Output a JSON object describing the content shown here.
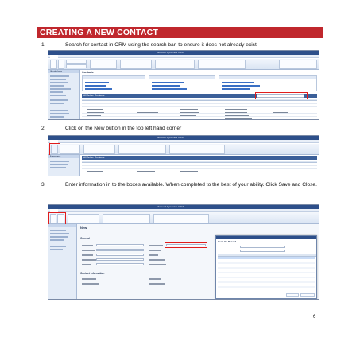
{
  "heading": "CREATING A NEW CONTACT",
  "steps": [
    {
      "number": "1.",
      "text": "Search for contact in CRM using the search bar, to ensure it does not already exist."
    },
    {
      "number": "2.",
      "text": "Click on the New button in the top left hand corner"
    },
    {
      "number": "3.",
      "text": "Enter information in to the boxes available.  When completed to the best of your ability.  Click Save and Close."
    }
  ],
  "screens": {
    "s1": {
      "window_title": "Microsoft Dynamics CRM",
      "nav_heading": "Workplace",
      "view_title": "Contacts",
      "view_name": "All Active Contacts"
    },
    "s2": {
      "window_title": "Microsoft Dynamics CRM",
      "nav_heading": "Members",
      "view_name": "All Active Contacts"
    },
    "s3": {
      "window_title": "Microsoft Dynamics CRM",
      "form_title": "New",
      "section": "General",
      "info_heading": "Contact Information",
      "lookup_title": "Look Up Record"
    }
  },
  "page_number": "6",
  "colors": {
    "banner": "#c0272d",
    "crm_blue": "#2d4f8a",
    "highlight": "#e01d1d"
  }
}
